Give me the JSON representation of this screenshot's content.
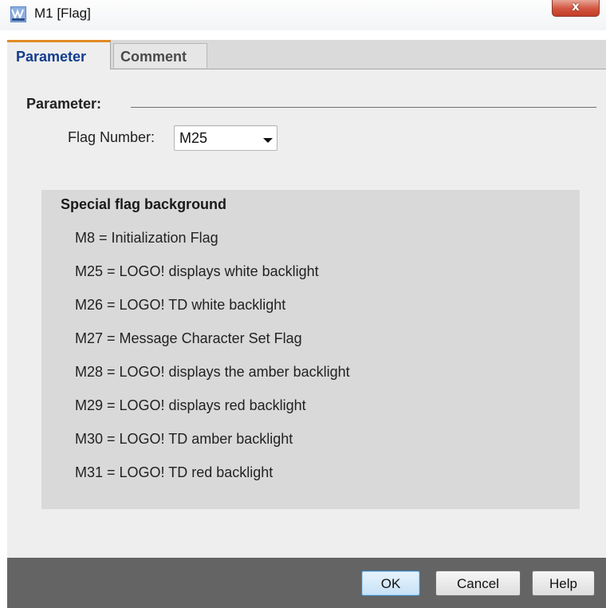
{
  "window": {
    "title": "M1 [Flag]",
    "app_icon": "logo-soft-comfort-icon",
    "close_label": "x"
  },
  "tabs": [
    {
      "label": "Parameter",
      "active": true
    },
    {
      "label": "Comment",
      "active": false
    }
  ],
  "parameter_section": {
    "heading": "Parameter:",
    "flag_number_label": "Flag Number:",
    "flag_number_value": "M25"
  },
  "info_box": {
    "title": "Special flag background",
    "lines": [
      "M8 = Initialization Flag",
      "M25 = LOGO! displays white backlight",
      "M26 = LOGO! TD white backlight",
      "M27 = Message Character Set Flag",
      "M28 = LOGO! displays the amber backlight",
      "M29 = LOGO! displays red backlight",
      "M30 = LOGO! TD amber backlight",
      "M31 = LOGO! TD red backlight"
    ]
  },
  "buttons": {
    "ok": "OK",
    "cancel": "Cancel",
    "help": "Help"
  },
  "colors": {
    "active_tab_text": "#123c8f",
    "active_tab_accent": "#e08a22",
    "close_button": "#d2543f",
    "bottom_bar": "#646464"
  }
}
